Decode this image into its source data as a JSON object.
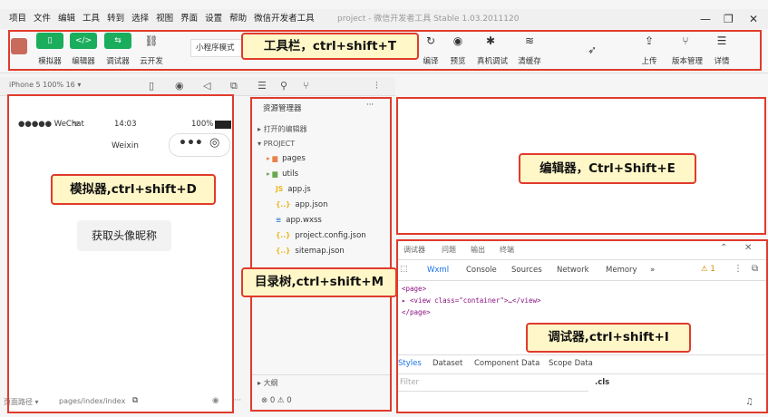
{
  "menu": [
    "项目",
    "文件",
    "编辑",
    "工具",
    "转到",
    "选择",
    "视图",
    "界面",
    "设置",
    "帮助",
    "微信开发者工具"
  ],
  "window_title": "project - 微信开发者工具 Stable 1.03.2011120",
  "window_controls": {
    "minimize": "—",
    "maximize": "❐",
    "close": "✕"
  },
  "toolbar": {
    "left": [
      {
        "label": "模拟器",
        "icon": "phone-icon",
        "glyph": "▯"
      },
      {
        "label": "编辑器",
        "icon": "code-icon",
        "glyph": "</>"
      },
      {
        "label": "调试器",
        "icon": "debug-switch-icon",
        "glyph": "⇆"
      },
      {
        "label": "云开发",
        "icon": "cloud-link-icon",
        "glyph": "⛓"
      }
    ],
    "mode": "小程序模式",
    "right": [
      {
        "label": "编译",
        "icon": "compile-icon",
        "glyph": "↻"
      },
      {
        "label": "预览",
        "icon": "eye-icon",
        "glyph": "◉"
      },
      {
        "label": "真机调试",
        "icon": "bug-icon",
        "glyph": "✱"
      },
      {
        "label": "清缓存",
        "icon": "layers-icon",
        "glyph": "≋"
      },
      {
        "label": "上传",
        "icon": "upload-icon",
        "glyph": "⇪"
      },
      {
        "label": "版本管理",
        "icon": "branch-icon",
        "glyph": "⑂"
      },
      {
        "label": "详情",
        "icon": "menu-icon",
        "glyph": "☰"
      }
    ]
  },
  "device_select": "iPhone 5 100% 16 ▾",
  "simulator": {
    "signal": "●●●●● WeChat",
    "wifi": "ᯤ",
    "time": "14:03",
    "battery": "100%",
    "title": "Weixin",
    "capsule_dots": "•••",
    "capsule_target": "◎",
    "button": "获取头像昵称",
    "footer_path_label": "页面路径 ▾",
    "footer_path": "pages/index/index",
    "footer_copy": "⧉",
    "footer_eye": "◉",
    "footer_more": "···"
  },
  "tree": {
    "header": "资源管理器",
    "header_more": "···",
    "open_editors": "打开的编辑器",
    "project": "PROJECT",
    "items": [
      {
        "name": "pages",
        "icon": "folder-icon",
        "glyph": "▸ ▆",
        "color": "#e8804a"
      },
      {
        "name": "utils",
        "icon": "folder-icon",
        "glyph": "▸ ▆",
        "color": "#6aa84f"
      },
      {
        "name": "app.js",
        "icon": "js-file-icon",
        "glyph": "JS",
        "color": "#e9b820"
      },
      {
        "name": "app.json",
        "icon": "json-file-icon",
        "glyph": "{..}",
        "color": "#e9b820"
      },
      {
        "name": "app.wxss",
        "icon": "wxss-file-icon",
        "glyph": "≡",
        "color": "#3d82d6"
      },
      {
        "name": "project.config.json",
        "icon": "json-file-icon",
        "glyph": "{..}",
        "color": "#e9b820"
      },
      {
        "name": "sitemap.json",
        "icon": "json-file-icon",
        "glyph": "{..}",
        "color": "#e9b820"
      }
    ],
    "outline": "大纲",
    "status": "⊗ 0 ⚠ 0"
  },
  "debugger": {
    "top_tabs": [
      "调试器",
      "问题",
      "输出",
      "终端"
    ],
    "tabs": [
      "Wxml",
      "Console",
      "Sources",
      "Network",
      "Memory",
      "»"
    ],
    "warn": "⚠ 1",
    "code": [
      "<page>",
      "▸ <view class=\"container\">…</view>",
      "</page>"
    ],
    "style_tabs": [
      "Styles",
      "Dataset",
      "Component Data",
      "Scope Data"
    ],
    "filter": "Filter",
    "cls": ".cls"
  },
  "callouts": {
    "toolbar": "工具栏，ctrl+shift+T",
    "simulator": "模拟器,ctrl+shift+D",
    "editor": "编辑器，Ctrl+Shift+E",
    "tree": "目录树,ctrl+shift+M",
    "debugger": "调试器,ctrl+shift+I"
  }
}
